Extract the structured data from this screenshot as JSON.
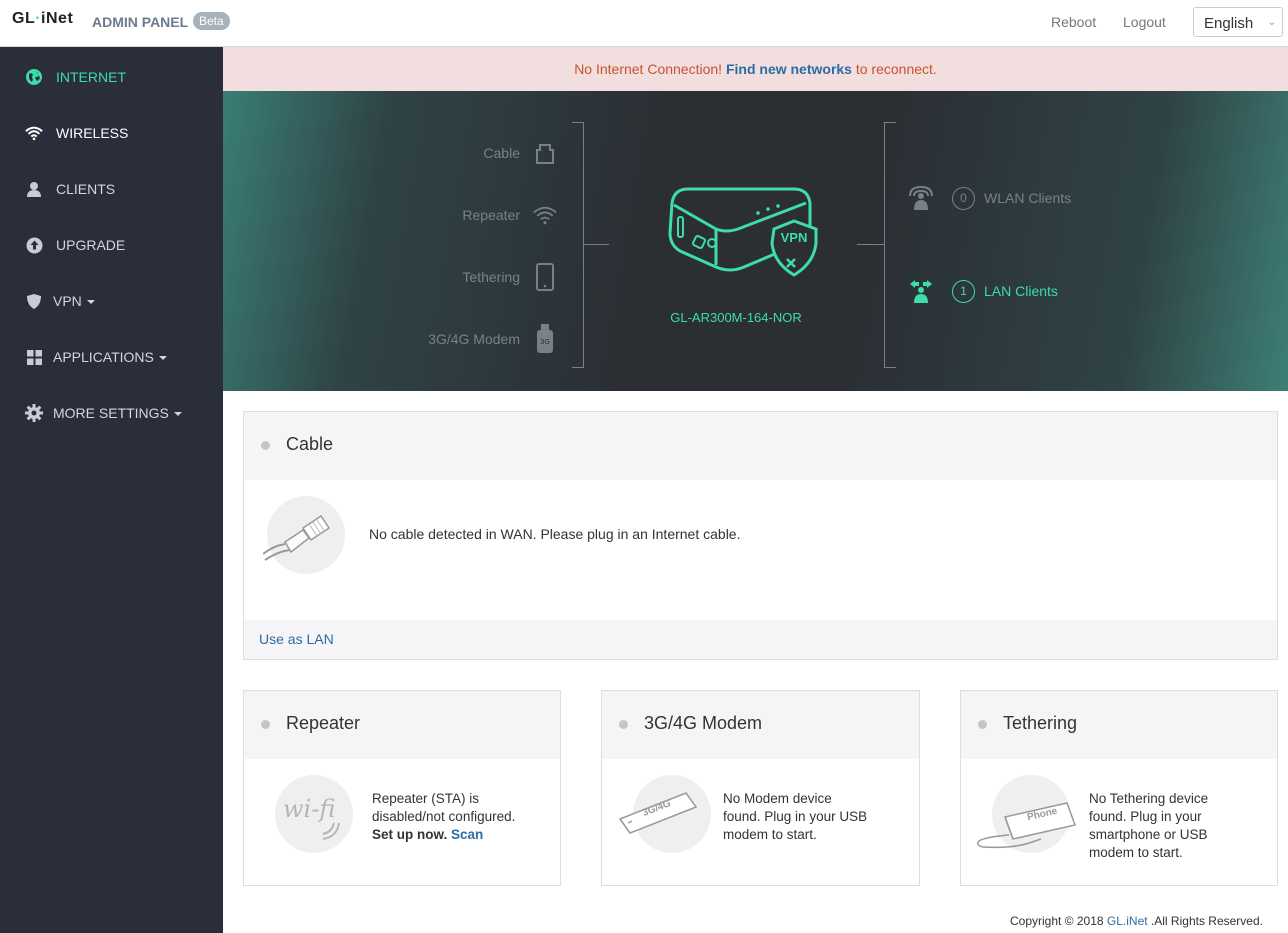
{
  "header": {
    "logo_left": "GL",
    "logo_mid": "·",
    "logo_right": "iNet",
    "admin_title": "ADMIN PANEL",
    "beta_badge": "Beta",
    "reboot": "Reboot",
    "logout": "Logout",
    "language": "English"
  },
  "sidebar": {
    "items": [
      {
        "label": "INTERNET",
        "icon": "globe-icon"
      },
      {
        "label": "WIRELESS",
        "icon": "wifi-icon"
      },
      {
        "label": "CLIENTS",
        "icon": "user-icon"
      },
      {
        "label": "UPGRADE",
        "icon": "upload-icon"
      },
      {
        "label": "VPN",
        "icon": "shield-icon"
      },
      {
        "label": "APPLICATIONS",
        "icon": "grid-icon"
      },
      {
        "label": "MORE SETTINGS",
        "icon": "gear-icon"
      }
    ]
  },
  "alert": {
    "prefix": "No Internet Connection! ",
    "link": "Find new networks",
    "suffix": " to reconnect."
  },
  "hero": {
    "sources": [
      "Cable",
      "Repeater",
      "Tethering",
      "3G/4G Modem"
    ],
    "device_name": "GL-AR300M-164-NOR",
    "vpn_badge": "VPN",
    "wlan_count": "0",
    "wlan_label": "WLAN Clients",
    "lan_count": "1",
    "lan_label": "LAN Clients"
  },
  "cable_panel": {
    "title": "Cable",
    "message": "No cable detected in WAN. Please plug in an Internet cable.",
    "footer_link": "Use as LAN"
  },
  "repeater_panel": {
    "title": "Repeater",
    "message_line1": "Repeater (STA) is",
    "message_line2": "disabled/not configured.",
    "setup": "Set up now.",
    "scan": "Scan"
  },
  "modem_panel": {
    "title": "3G/4G Modem",
    "message_line1": "No Modem device",
    "message_line2": "found. Plug in your USB",
    "message_line3": "modem to start.",
    "usb_label": "3G/4G"
  },
  "tethering_panel": {
    "title": "Tethering",
    "message_line1": "No Tethering device",
    "message_line2": "found. Plug in your",
    "message_line3": "smartphone or USB",
    "message_line4": "modem to start.",
    "phone_label": "Phone"
  },
  "footer": {
    "prefix": "Copyright © 2018 ",
    "link": "GL.iNet",
    "suffix": " .All Rights Reserved."
  },
  "colors": {
    "accent": "#3ddca8",
    "sidebar_bg": "#2a2d3a",
    "link": "#2d6ca2",
    "alert_bg": "#f2dede",
    "alert_text": "#c7532b"
  }
}
